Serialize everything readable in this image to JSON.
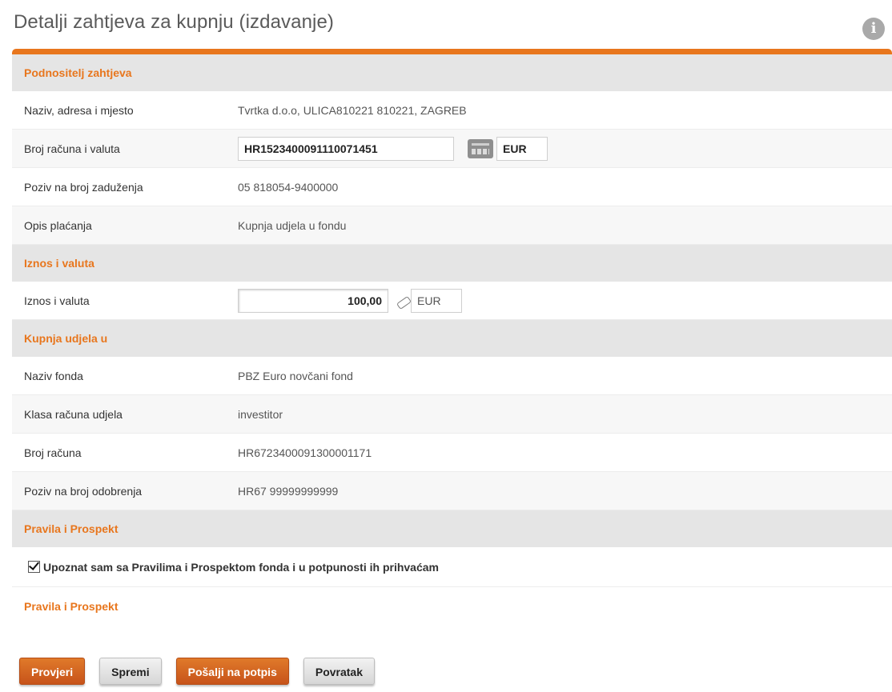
{
  "page": {
    "title": "Detalji zahtjeva za kupnju (izdavanje)",
    "info_icon": "info-icon"
  },
  "sections": {
    "applicant": "Podnositelj zahtjeva",
    "amount": "Iznos i valuta",
    "purchase": "Kupnja udjela u",
    "rules": "Pravila i Prospekt"
  },
  "applicant": {
    "name_label": "Naziv, adresa i mjesto",
    "name_value": "Tvrtka d.o.o, ULICA810221 810221, ZAGREB",
    "account_label": "Broj računa i valuta",
    "account_value": "HR1523400091110071451",
    "account_currency": "EUR",
    "debit_ref_label": "Poziv na broj zaduženja",
    "debit_ref_value": "05 818054-9400000",
    "desc_label": "Opis plaćanja",
    "desc_value": "Kupnja udjela u fondu"
  },
  "amount": {
    "label": "Iznos i valuta",
    "value": "100,00",
    "currency": "EUR"
  },
  "purchase": {
    "fund_label": "Naziv fonda",
    "fund_value": "PBZ Euro novčani fond",
    "class_label": "Klasa računa udjela",
    "class_value": "investitor",
    "account_label": "Broj računa",
    "account_value": "HR6723400091300001171",
    "credit_ref_label": "Poziv na broj odobrenja",
    "credit_ref_value": "HR67 99999999999"
  },
  "rules": {
    "accept_checked": true,
    "accept_text": "Upoznat sam sa Pravilima i Prospektom fonda i u potpunosti ih prihvaćam",
    "link_text": "Pravila i Prospekt"
  },
  "buttons": {
    "check": "Provjeri",
    "save": "Spremi",
    "send": "Pošalji na potpis",
    "back": "Povratak"
  },
  "colors": {
    "accent": "#e8761d",
    "section_bg": "#e5e5e5"
  }
}
